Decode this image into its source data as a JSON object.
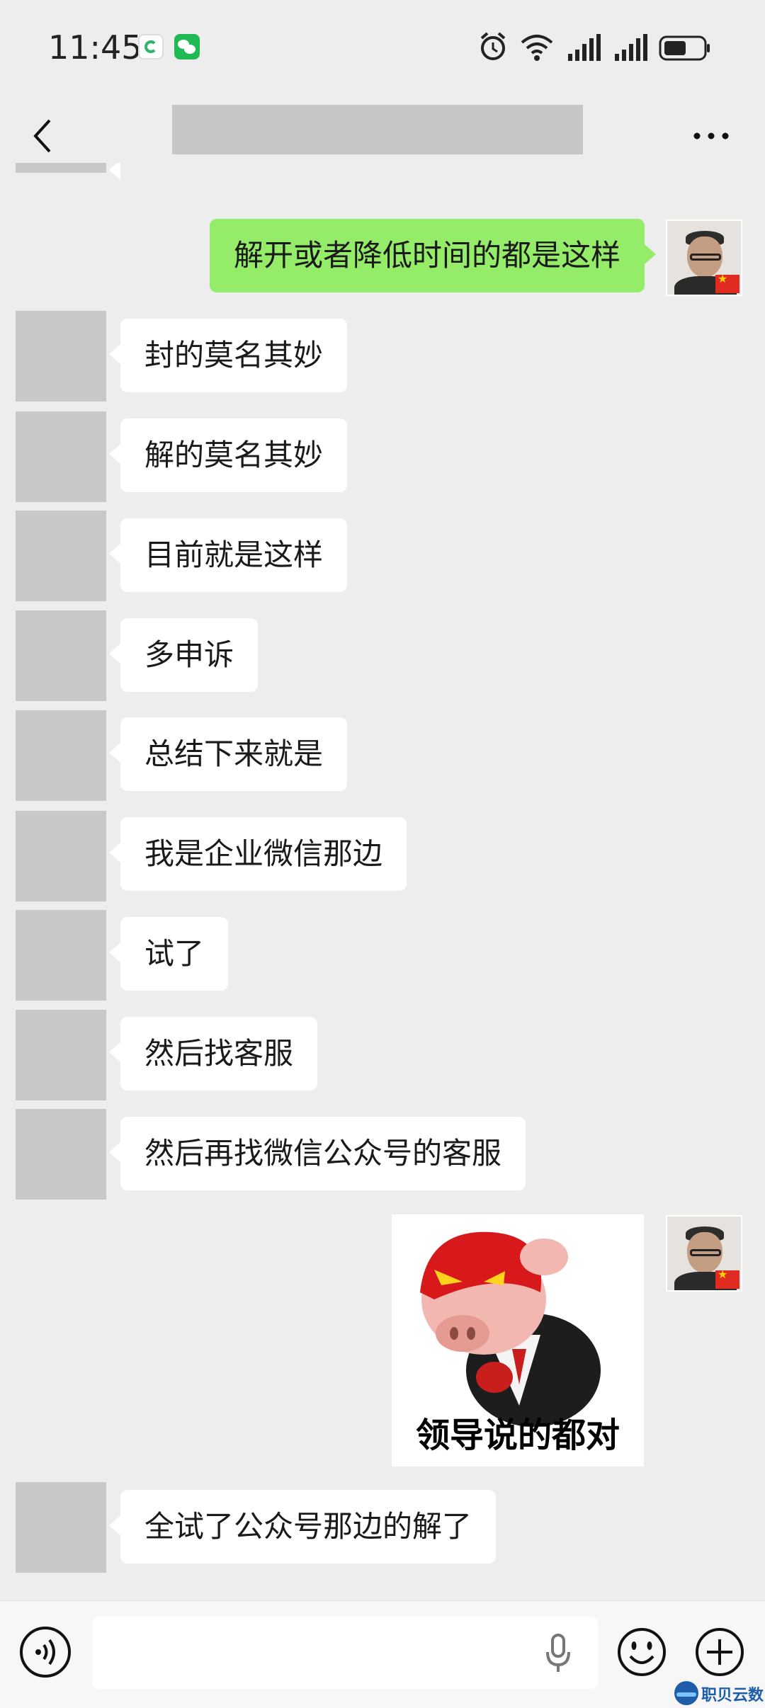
{
  "status_bar": {
    "time": "11:45",
    "icons": [
      "app-notification-icon",
      "wechat-icon",
      "alarm-icon",
      "wifi-icon",
      "signal-icon",
      "signal-icon",
      "battery-icon"
    ]
  },
  "header": {
    "title": "",
    "back_icon": "chevron-left-icon",
    "more_icon": "more-dots-icon"
  },
  "messages": [
    {
      "side": "right",
      "text": "解开或者降低时间的都是这样"
    },
    {
      "side": "left",
      "text": "封的莫名其妙"
    },
    {
      "side": "left",
      "text": "解的莫名其妙"
    },
    {
      "side": "left",
      "text": "目前就是这样"
    },
    {
      "side": "left",
      "text": "多申诉"
    },
    {
      "side": "left",
      "text": "总结下来就是"
    },
    {
      "side": "left",
      "text": "我是企业微信那边"
    },
    {
      "side": "left",
      "text": "试了"
    },
    {
      "side": "left",
      "text": "然后找客服"
    },
    {
      "side": "left",
      "text": "然后再找微信公众号的客服"
    },
    {
      "side": "right",
      "type": "sticker",
      "text": "领导说的都对"
    },
    {
      "side": "left",
      "text": "全试了公众号那边的解了"
    }
  ],
  "input_bar": {
    "placeholder": "",
    "icons": [
      "voice-icon",
      "microphone-icon",
      "emoji-icon",
      "plus-icon"
    ]
  },
  "watermark": "职贝云数"
}
